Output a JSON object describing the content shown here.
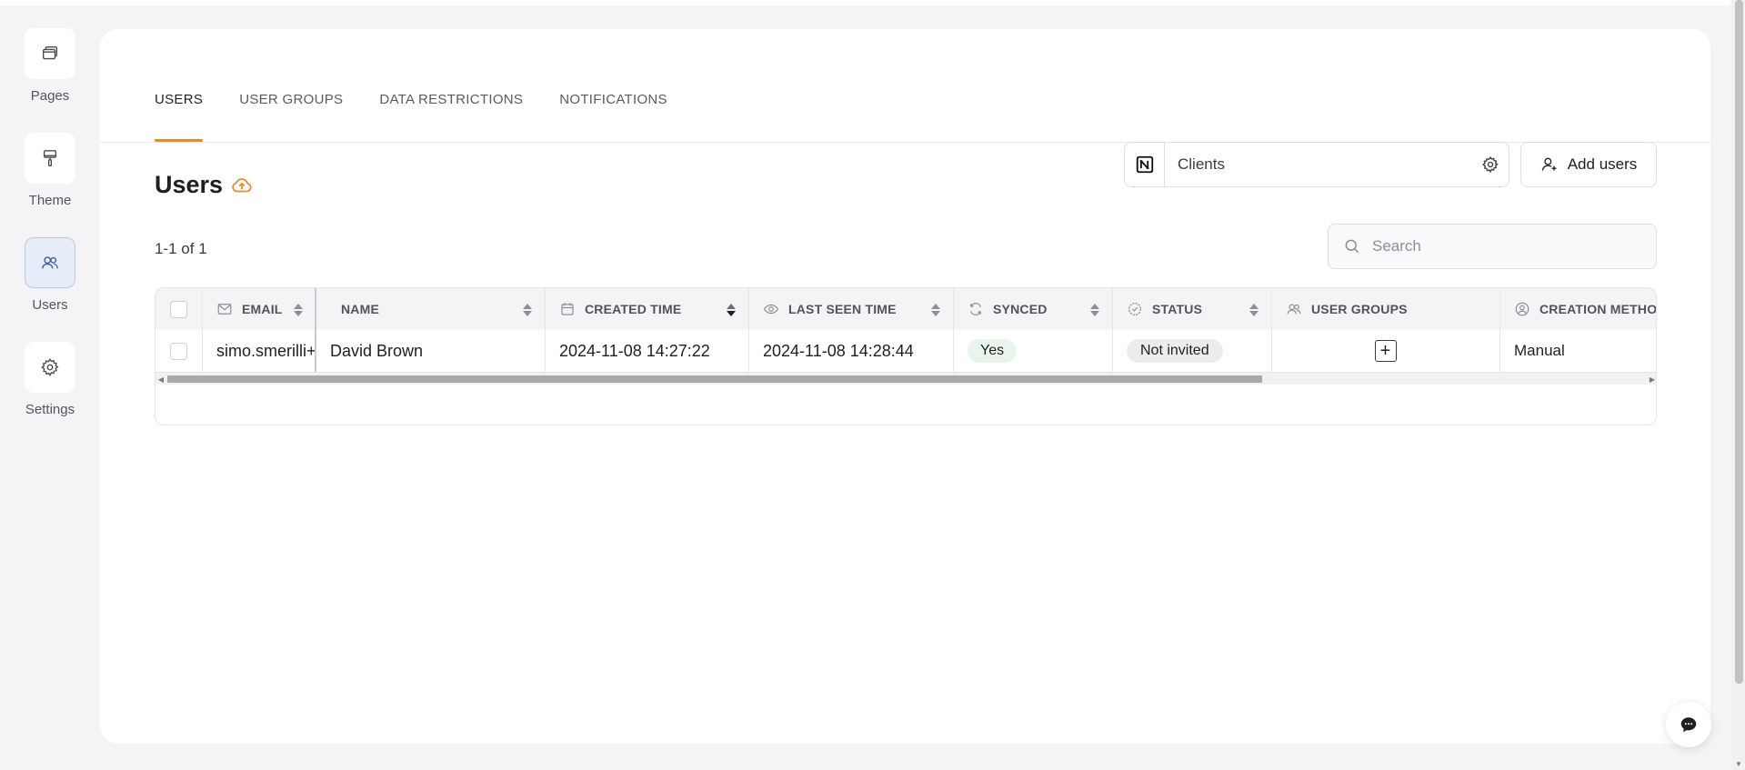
{
  "sidebar": {
    "items": [
      {
        "label": "Pages",
        "icon": "pages-icon"
      },
      {
        "label": "Theme",
        "icon": "paint-roller-icon"
      },
      {
        "label": "Users",
        "icon": "users-icon",
        "active": true
      },
      {
        "label": "Settings",
        "icon": "gear-icon"
      }
    ]
  },
  "tabs": [
    {
      "label": "USERS",
      "active": true
    },
    {
      "label": "USER GROUPS"
    },
    {
      "label": "DATA RESTRICTIONS"
    },
    {
      "label": "NOTIFICATIONS"
    }
  ],
  "header": {
    "title": "Users",
    "title_icon": "cloud-upload-icon",
    "source_name": "Clients",
    "source_logo": "notion-icon",
    "add_users_label": "Add users"
  },
  "list": {
    "count_text": "1-1 of 1"
  },
  "search": {
    "placeholder": "Search"
  },
  "table": {
    "columns": [
      {
        "label": "EMAIL",
        "icon": "mail-icon"
      },
      {
        "label": "NAME"
      },
      {
        "label": "CREATED TIME",
        "icon": "calendar-icon",
        "sorted": true
      },
      {
        "label": "LAST SEEN TIME",
        "icon": "eye-icon"
      },
      {
        "label": "SYNCED",
        "icon": "sync-icon"
      },
      {
        "label": "STATUS",
        "icon": "check-badge-icon"
      },
      {
        "label": "USER GROUPS",
        "icon": "users-icon"
      },
      {
        "label": "CREATION METHO",
        "icon": "user-circle-icon"
      }
    ],
    "rows": [
      {
        "email": "simo.smerilli+",
        "name": "David Brown",
        "created_time": "2024-11-08 14:27:22",
        "last_seen_time": "2024-11-08 14:28:44",
        "synced": "Yes",
        "status": "Not invited",
        "user_groups_action": "+",
        "creation_method": "Manual"
      }
    ]
  },
  "colors": {
    "accent": "#e8892b",
    "active_nav_bg": "#e6edf8",
    "synced_pill": "#e8f4ec",
    "status_pill": "#ececef"
  }
}
